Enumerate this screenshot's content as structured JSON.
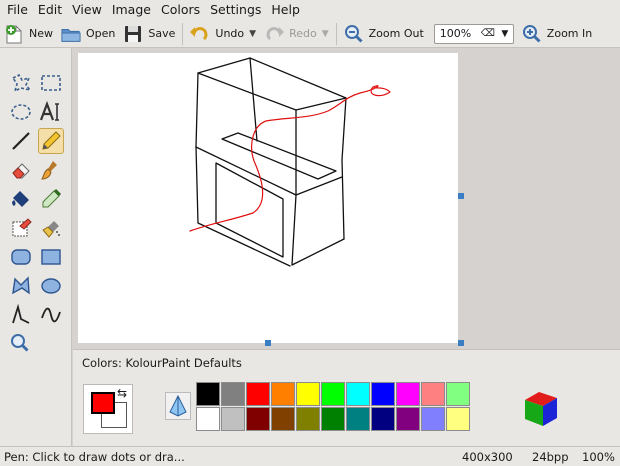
{
  "menu": [
    "File",
    "Edit",
    "View",
    "Image",
    "Colors",
    "Settings",
    "Help"
  ],
  "toolbar": {
    "new_label": "New",
    "open_label": "Open",
    "save_label": "Save",
    "undo_label": "Undo",
    "redo_label": "Redo",
    "zoom_out_label": "Zoom Out",
    "zoom_value": "100%",
    "zoom_in_label": "Zoom In"
  },
  "tools": [
    "free-form-selection-icon",
    "rectangular-selection-icon",
    "elliptical-selection-icon",
    "text-icon",
    "line-icon",
    "pen-icon",
    "eraser-icon",
    "brush-icon",
    "flood-fill-icon",
    "color-picker-icon",
    "color-eraser-icon",
    "spraycan-icon",
    "rounded-rectangle-icon",
    "rectangle-icon",
    "polygon-icon",
    "ellipse-icon",
    "connected-lines-icon",
    "curve-icon",
    "zoom-icon"
  ],
  "colorbox": {
    "title_prefix": "Colors: ",
    "title_name": "KolourPaint Defaults",
    "foreground": "#ff0000",
    "background": "#ffffff",
    "palette_row1": [
      "#000000",
      "#808080",
      "#ff0000",
      "#ff8000",
      "#ffff00",
      "#00ff00",
      "#00ffff",
      "#0000ff",
      "#ff00ff",
      "#ff8080",
      "#80ff80"
    ],
    "palette_row2": [
      "#ffffff",
      "#c0c0c0",
      "#800000",
      "#804000",
      "#808000",
      "#008000",
      "#008080",
      "#000080",
      "#800080",
      "#8080ff",
      "#ffff80"
    ]
  },
  "status": {
    "message": "Pen: Click to draw dots or dra...",
    "dimensions": "400x300",
    "depth": "24bpp",
    "zoom": "100%"
  }
}
